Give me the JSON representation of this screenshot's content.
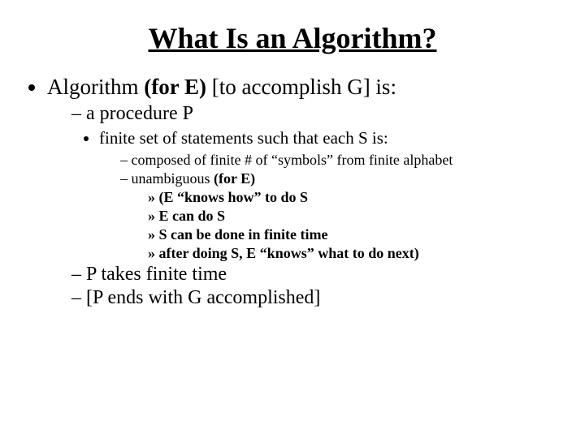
{
  "title": "What Is an Algorithm?",
  "lvl1": {
    "pre": "Algorithm ",
    "bold": "(for E) ",
    "post": "[to accomplish G] is:"
  },
  "lvl2_a": "a procedure P",
  "lvl3_a": "finite set of statements such that each S is:",
  "lvl4_a": "composed of finite # of “symbols” from finite alphabet",
  "lvl4_b_pre": "unambiguous ",
  "lvl4_b_bold": "(for E)",
  "lvl5_a": "(E “knows how” to do S",
  "lvl5_b": "E can do S",
  "lvl5_c": "S can be done in finite time",
  "lvl5_d": "after doing S, E “knows” what to do next)",
  "lvl2_b": " P takes finite time",
  "lvl2_c": "[P ends with G accomplished]"
}
